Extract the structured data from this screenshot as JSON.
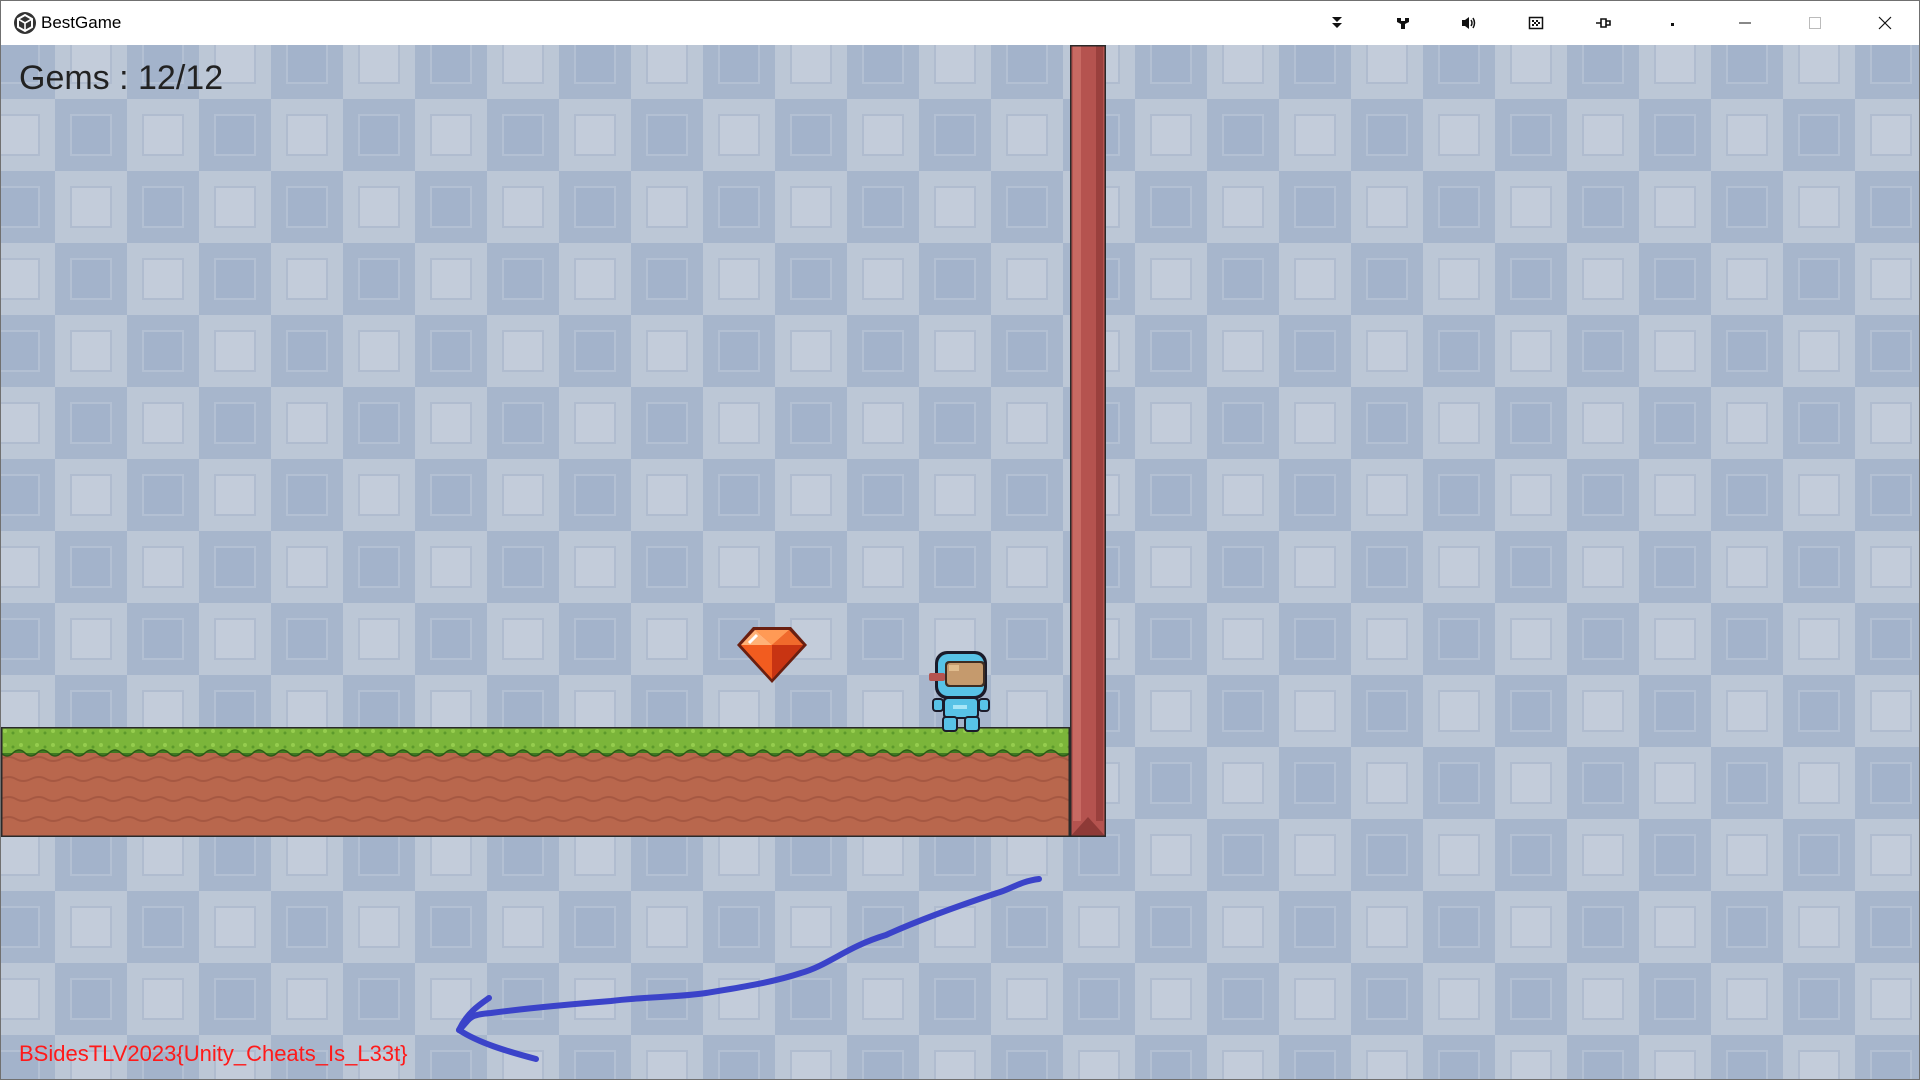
{
  "window": {
    "title": "BestGame",
    "icon": "unity-icon"
  },
  "titlebar_buttons": [
    {
      "name": "collapse-icon"
    },
    {
      "name": "tools-icon"
    },
    {
      "name": "volume-icon"
    },
    {
      "name": "grid-toggle-icon"
    },
    {
      "name": "pin-icon"
    },
    {
      "name": "dot-icon"
    },
    {
      "name": "minimize-icon"
    },
    {
      "name": "maximize-icon"
    },
    {
      "name": "close-icon"
    }
  ],
  "hud": {
    "gems_label": "Gems : 12/12"
  },
  "overlay": {
    "flag_text": "BSidesTLV2023{Unity_Cheats_Is_L33t}"
  },
  "colors": {
    "flag": "#ff1a1a",
    "scribble": "#3b43c9",
    "wall": "#b5534f",
    "grass": "#7bb53a",
    "dirt": "#b9674d"
  }
}
